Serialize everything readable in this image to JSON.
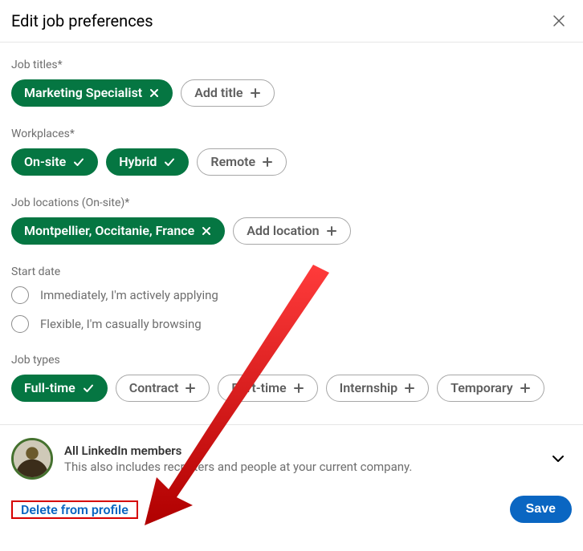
{
  "header": {
    "title": "Edit job preferences"
  },
  "job_titles": {
    "label": "Job titles*",
    "selected": "Marketing Specialist",
    "add": "Add title"
  },
  "workplaces": {
    "label": "Workplaces*",
    "onsite": "On-site",
    "hybrid": "Hybrid",
    "remote": "Remote"
  },
  "locations": {
    "label": "Job locations (On-site)*",
    "selected": "Montpellier, Occitanie, France",
    "add": "Add location"
  },
  "start_date": {
    "label": "Start date",
    "opt1": "Immediately, I'm actively applying",
    "opt2": "Flexible, I'm casually browsing"
  },
  "job_types": {
    "label": "Job types",
    "fulltime": "Full-time",
    "contract": "Contract",
    "parttime": "Part-time",
    "internship": "Internship",
    "temporary": "Temporary"
  },
  "visibility": {
    "title": "All LinkedIn members",
    "sub": "This also includes recruiters and people at your current company."
  },
  "footer": {
    "delete": "Delete from profile",
    "save": "Save"
  }
}
